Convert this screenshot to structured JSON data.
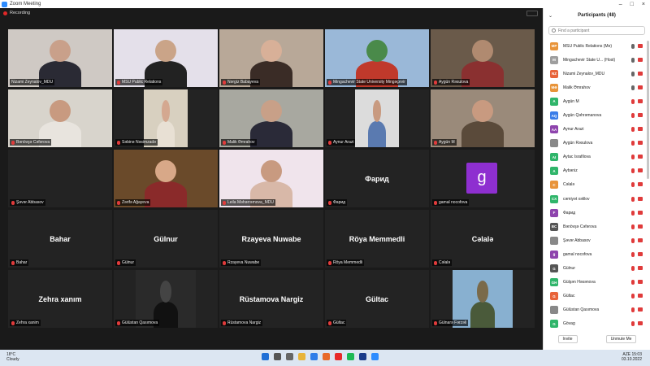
{
  "window": {
    "title": "Zoom Meeting"
  },
  "recording": {
    "label": "Recording"
  },
  "tiles": [
    {
      "name": "Nizami Zeynalov_MDU",
      "type": "video",
      "active": true
    },
    {
      "name": "MSU Public Relations",
      "type": "video"
    },
    {
      "name": "Nərgiz Babayeva",
      "type": "video"
    },
    {
      "name": "Mingachevir State University Mingəçevir",
      "type": "video"
    },
    {
      "name": "Aygün Rəsulova",
      "type": "video"
    },
    {
      "name": "Bənövşə Cəfərova",
      "type": "video"
    },
    {
      "name": "Səbinə Nəsimzadə",
      "type": "video"
    },
    {
      "name": "Malik Əmrahov",
      "type": "video"
    },
    {
      "name": "Aynur Arazi",
      "type": "video"
    },
    {
      "name": "Aygün M",
      "type": "video"
    },
    {
      "name": "Şəvər Abbasov",
      "type": "blank"
    },
    {
      "name": "Zərifə Ağayeva",
      "type": "video"
    },
    {
      "name": "Leila Məhərrəmova_MDU",
      "type": "video"
    },
    {
      "name": "Фарид",
      "type": "name",
      "display": "Фарид"
    },
    {
      "name": "gamal nocofova",
      "type": "avatar",
      "letter": "g"
    },
    {
      "name": "Bahar",
      "type": "name",
      "display": "Bahar"
    },
    {
      "name": "Gülnur",
      "type": "name",
      "display": "Gülnur"
    },
    {
      "name": "Rzayeva Nuwabe",
      "type": "name",
      "display": "Rzayeva Nuwabe"
    },
    {
      "name": "Röya Memmedli",
      "type": "name",
      "display": "Röya Memmedli"
    },
    {
      "name": "Cəlalə",
      "type": "name",
      "display": "Cəlalə"
    },
    {
      "name": "Zehra xanim",
      "type": "name",
      "display": "Zehra xanım"
    },
    {
      "name": "Gülüstan Qasımova",
      "type": "video"
    },
    {
      "name": "Rüstamova Nargiz",
      "type": "name",
      "display": "Rüstamova Nargiz"
    },
    {
      "name": "Gültac",
      "type": "name",
      "display": "Gültac"
    },
    {
      "name": "Gülnarə Fərzəli",
      "type": "video"
    }
  ],
  "participants_panel": {
    "title": "Participants (48)",
    "search_placeholder": "Find a participant",
    "invite_label": "Invite",
    "unmute_label": "Unmute Me",
    "participants": [
      {
        "initials": "MP",
        "color": "#e8943a",
        "name": "MSU Public Relations (Me)",
        "mic": "grey"
      },
      {
        "initials": "M",
        "color": "#9e9e9e",
        "name": "Mingachevir State U... (Host)",
        "mic": "grey"
      },
      {
        "initials": "NZ",
        "color": "#e8643a",
        "name": "Nizami Zeynalov_MDU",
        "mic": "grey"
      },
      {
        "initials": "MƏ",
        "color": "#e8943a",
        "name": "Malik Əmrahov",
        "mic": "grey"
      },
      {
        "initials": "A",
        "color": "#2fb56a",
        "name": "Aygün M",
        "mic": "red"
      },
      {
        "initials": "AQ",
        "color": "#3a7de8",
        "name": "Aygün Qəhrəmanova",
        "mic": "red"
      },
      {
        "initials": "AA",
        "color": "#8e44ad",
        "name": "Aynur Arazi",
        "mic": "red"
      },
      {
        "initials": "",
        "color": "#888888",
        "name": "Aygün Rəsulova",
        "mic": "red"
      },
      {
        "initials": "AI",
        "color": "#2fb56a",
        "name": "Aytac İsrafilova",
        "mic": "red"
      },
      {
        "initials": "A",
        "color": "#2fb56a",
        "name": "Aybəniz",
        "mic": "red"
      },
      {
        "initials": "C",
        "color": "#e8943a",
        "name": "Cəlalə",
        "mic": "red"
      },
      {
        "initials": "CX",
        "color": "#2fb56a",
        "name": "cəmiyət xəlilov",
        "mic": "red"
      },
      {
        "initials": "F",
        "color": "#8e44ad",
        "name": "Фарид",
        "mic": "red"
      },
      {
        "initials": "BC",
        "color": "#555555",
        "name": "Bənövşə Cəfərova",
        "mic": "red"
      },
      {
        "initials": "",
        "color": "#888888",
        "name": "Şəvər Abbasov",
        "mic": "red"
      },
      {
        "initials": "g",
        "color": "#8e44ad",
        "name": "gamal nocofova",
        "mic": "red"
      },
      {
        "initials": "G",
        "color": "#555555",
        "name": "Gülnur",
        "mic": "red"
      },
      {
        "initials": "GH",
        "color": "#2fb56a",
        "name": "Gülşən Həsənova",
        "mic": "red"
      },
      {
        "initials": "G",
        "color": "#e8643a",
        "name": "Gültac",
        "mic": "red"
      },
      {
        "initials": "",
        "color": "#888888",
        "name": "Gülüstan Qasımova",
        "mic": "red"
      },
      {
        "initials": "G",
        "color": "#2fb56a",
        "name": "Gövag",
        "mic": "red"
      }
    ]
  },
  "taskbar": {
    "weather_temp": "18°C",
    "weather_desc": "Cloudy",
    "lang": "AZE",
    "time": "15:03",
    "date": "03.10.2022"
  }
}
